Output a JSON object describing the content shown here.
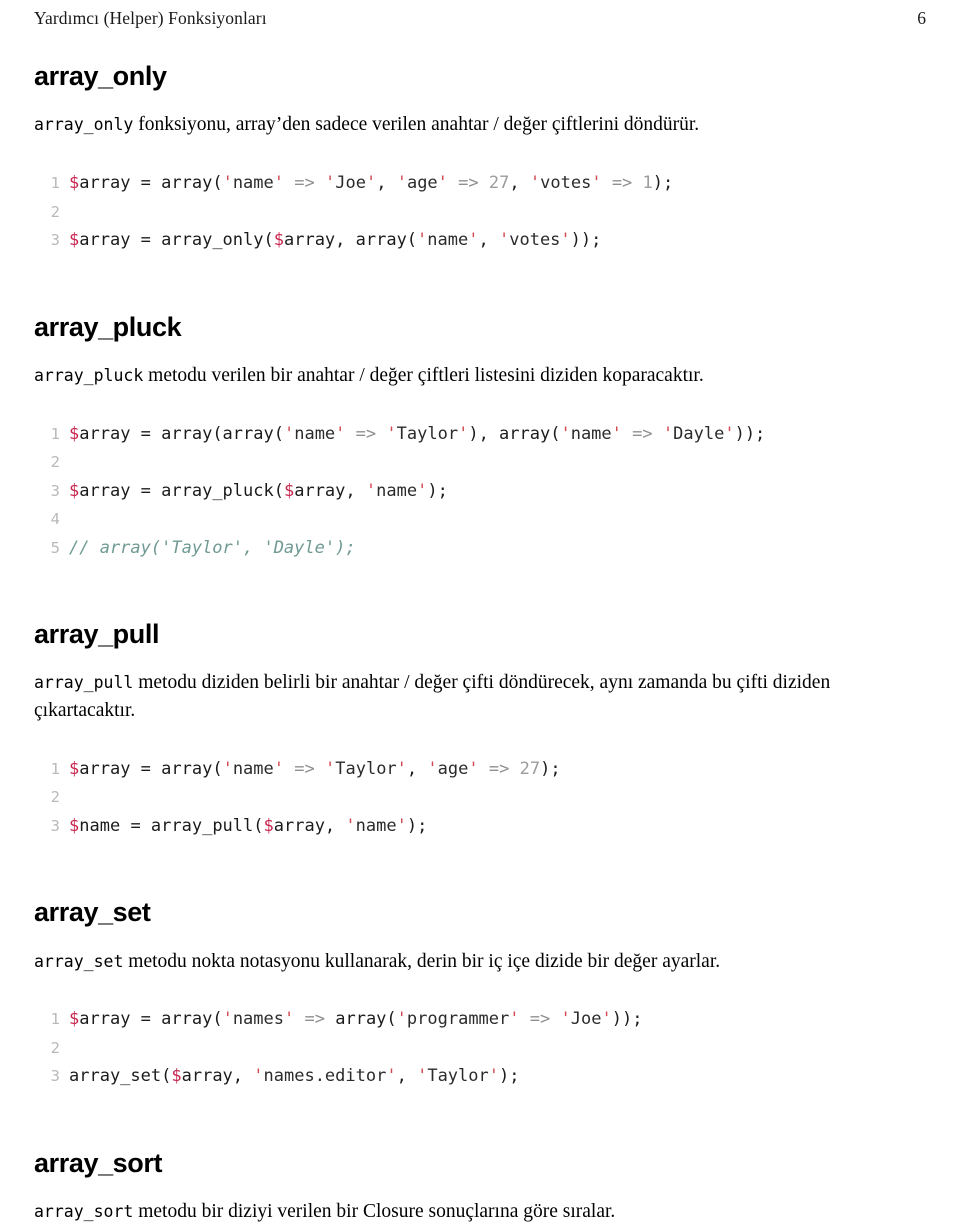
{
  "header": {
    "title": "Yardımcı (Helper) Fonksiyonları",
    "page_number": "6"
  },
  "colors": {
    "variable": "#c7254e",
    "quote": "#d14b52",
    "string": "#2b2b2b",
    "number": "#9c9c9c",
    "operator": "#8f8f8f",
    "comment": "#6f9a93",
    "gutter": "#b9b9b9",
    "text": "#000000",
    "background": "#ffffff"
  },
  "sections": [
    {
      "heading": "array_only",
      "paragraph": {
        "code": "array_only",
        "rest": " fonksiyonu, array’den sadece verilen anahtar / değer çiftlerini döndürür."
      },
      "code_lines": [
        {
          "n": "1",
          "tokens": [
            {
              "t": "$",
              "c": "var"
            },
            {
              "t": "array ",
              "c": "plain"
            },
            {
              "t": "= array(",
              "c": "plain"
            },
            {
              "t": "'",
              "c": "quote"
            },
            {
              "t": "name",
              "c": "str"
            },
            {
              "t": "'",
              "c": "quote"
            },
            {
              "t": " ",
              "c": "plain"
            },
            {
              "t": "=>",
              "c": "op"
            },
            {
              "t": " ",
              "c": "plain"
            },
            {
              "t": "'",
              "c": "quote"
            },
            {
              "t": "Joe",
              "c": "str"
            },
            {
              "t": "'",
              "c": "quote"
            },
            {
              "t": ", ",
              "c": "plain"
            },
            {
              "t": "'",
              "c": "quote"
            },
            {
              "t": "age",
              "c": "str"
            },
            {
              "t": "'",
              "c": "quote"
            },
            {
              "t": " ",
              "c": "plain"
            },
            {
              "t": "=>",
              "c": "op"
            },
            {
              "t": " ",
              "c": "plain"
            },
            {
              "t": "27",
              "c": "num"
            },
            {
              "t": ", ",
              "c": "plain"
            },
            {
              "t": "'",
              "c": "quote"
            },
            {
              "t": "votes",
              "c": "str"
            },
            {
              "t": "'",
              "c": "quote"
            },
            {
              "t": " ",
              "c": "plain"
            },
            {
              "t": "=>",
              "c": "op"
            },
            {
              "t": " ",
              "c": "plain"
            },
            {
              "t": "1",
              "c": "num"
            },
            {
              "t": ");",
              "c": "plain"
            }
          ]
        },
        {
          "n": "2",
          "tokens": []
        },
        {
          "n": "3",
          "tokens": [
            {
              "t": "$",
              "c": "var"
            },
            {
              "t": "array ",
              "c": "plain"
            },
            {
              "t": "= array_only(",
              "c": "plain"
            },
            {
              "t": "$",
              "c": "var"
            },
            {
              "t": "array, array(",
              "c": "plain"
            },
            {
              "t": "'",
              "c": "quote"
            },
            {
              "t": "name",
              "c": "str"
            },
            {
              "t": "'",
              "c": "quote"
            },
            {
              "t": ", ",
              "c": "plain"
            },
            {
              "t": "'",
              "c": "quote"
            },
            {
              "t": "votes",
              "c": "str"
            },
            {
              "t": "'",
              "c": "quote"
            },
            {
              "t": "));",
              "c": "plain"
            }
          ]
        }
      ]
    },
    {
      "heading": "array_pluck",
      "paragraph": {
        "code": "array_pluck",
        "rest": " metodu verilen bir anahtar / değer çiftleri listesini diziden koparacaktır."
      },
      "code_lines": [
        {
          "n": "1",
          "tokens": [
            {
              "t": "$",
              "c": "var"
            },
            {
              "t": "array ",
              "c": "plain"
            },
            {
              "t": "= array(array(",
              "c": "plain"
            },
            {
              "t": "'",
              "c": "quote"
            },
            {
              "t": "name",
              "c": "str"
            },
            {
              "t": "'",
              "c": "quote"
            },
            {
              "t": " ",
              "c": "plain"
            },
            {
              "t": "=>",
              "c": "op"
            },
            {
              "t": " ",
              "c": "plain"
            },
            {
              "t": "'",
              "c": "quote"
            },
            {
              "t": "Taylor",
              "c": "str"
            },
            {
              "t": "'",
              "c": "quote"
            },
            {
              "t": "), array(",
              "c": "plain"
            },
            {
              "t": "'",
              "c": "quote"
            },
            {
              "t": "name",
              "c": "str"
            },
            {
              "t": "'",
              "c": "quote"
            },
            {
              "t": " ",
              "c": "plain"
            },
            {
              "t": "=>",
              "c": "op"
            },
            {
              "t": " ",
              "c": "plain"
            },
            {
              "t": "'",
              "c": "quote"
            },
            {
              "t": "Dayle",
              "c": "str"
            },
            {
              "t": "'",
              "c": "quote"
            },
            {
              "t": "));",
              "c": "plain"
            }
          ]
        },
        {
          "n": "2",
          "tokens": []
        },
        {
          "n": "3",
          "tokens": [
            {
              "t": "$",
              "c": "var"
            },
            {
              "t": "array ",
              "c": "plain"
            },
            {
              "t": "= array_pluck(",
              "c": "plain"
            },
            {
              "t": "$",
              "c": "var"
            },
            {
              "t": "array, ",
              "c": "plain"
            },
            {
              "t": "'",
              "c": "quote"
            },
            {
              "t": "name",
              "c": "str"
            },
            {
              "t": "'",
              "c": "quote"
            },
            {
              "t": ");",
              "c": "plain"
            }
          ]
        },
        {
          "n": "4",
          "tokens": []
        },
        {
          "n": "5",
          "tokens": [
            {
              "t": "// array('Taylor', 'Dayle');",
              "c": "comment"
            }
          ]
        }
      ]
    },
    {
      "heading": "array_pull",
      "paragraph": {
        "code": "array_pull",
        "rest": " metodu diziden belirli bir anahtar / değer çifti döndürecek, aynı zamanda bu çifti diziden çıkartacaktır."
      },
      "code_lines": [
        {
          "n": "1",
          "tokens": [
            {
              "t": "$",
              "c": "var"
            },
            {
              "t": "array ",
              "c": "plain"
            },
            {
              "t": "= array(",
              "c": "plain"
            },
            {
              "t": "'",
              "c": "quote"
            },
            {
              "t": "name",
              "c": "str"
            },
            {
              "t": "'",
              "c": "quote"
            },
            {
              "t": " ",
              "c": "plain"
            },
            {
              "t": "=>",
              "c": "op"
            },
            {
              "t": " ",
              "c": "plain"
            },
            {
              "t": "'",
              "c": "quote"
            },
            {
              "t": "Taylor",
              "c": "str"
            },
            {
              "t": "'",
              "c": "quote"
            },
            {
              "t": ", ",
              "c": "plain"
            },
            {
              "t": "'",
              "c": "quote"
            },
            {
              "t": "age",
              "c": "str"
            },
            {
              "t": "'",
              "c": "quote"
            },
            {
              "t": " ",
              "c": "plain"
            },
            {
              "t": "=>",
              "c": "op"
            },
            {
              "t": " ",
              "c": "plain"
            },
            {
              "t": "27",
              "c": "num"
            },
            {
              "t": ");",
              "c": "plain"
            }
          ]
        },
        {
          "n": "2",
          "tokens": []
        },
        {
          "n": "3",
          "tokens": [
            {
              "t": "$",
              "c": "var"
            },
            {
              "t": "name ",
              "c": "plain"
            },
            {
              "t": "= array_pull(",
              "c": "plain"
            },
            {
              "t": "$",
              "c": "var"
            },
            {
              "t": "array, ",
              "c": "plain"
            },
            {
              "t": "'",
              "c": "quote"
            },
            {
              "t": "name",
              "c": "str"
            },
            {
              "t": "'",
              "c": "quote"
            },
            {
              "t": ");",
              "c": "plain"
            }
          ]
        }
      ]
    },
    {
      "heading": "array_set",
      "paragraph": {
        "code": "array_set",
        "rest": " metodu nokta notasyonu kullanarak, derin bir iç içe dizide bir değer ayarlar."
      },
      "code_lines": [
        {
          "n": "1",
          "tokens": [
            {
              "t": "$",
              "c": "var"
            },
            {
              "t": "array ",
              "c": "plain"
            },
            {
              "t": "= array(",
              "c": "plain"
            },
            {
              "t": "'",
              "c": "quote"
            },
            {
              "t": "names",
              "c": "str"
            },
            {
              "t": "'",
              "c": "quote"
            },
            {
              "t": " ",
              "c": "plain"
            },
            {
              "t": "=>",
              "c": "op"
            },
            {
              "t": " ",
              "c": "plain"
            },
            {
              "t": "array(",
              "c": "plain"
            },
            {
              "t": "'",
              "c": "quote"
            },
            {
              "t": "programmer",
              "c": "str"
            },
            {
              "t": "'",
              "c": "quote"
            },
            {
              "t": " ",
              "c": "plain"
            },
            {
              "t": "=>",
              "c": "op"
            },
            {
              "t": " ",
              "c": "plain"
            },
            {
              "t": "'",
              "c": "quote"
            },
            {
              "t": "Joe",
              "c": "str"
            },
            {
              "t": "'",
              "c": "quote"
            },
            {
              "t": "));",
              "c": "plain"
            }
          ]
        },
        {
          "n": "2",
          "tokens": []
        },
        {
          "n": "3",
          "tokens": [
            {
              "t": "array_set(",
              "c": "plain"
            },
            {
              "t": "$",
              "c": "var"
            },
            {
              "t": "array, ",
              "c": "plain"
            },
            {
              "t": "'",
              "c": "quote"
            },
            {
              "t": "names.editor",
              "c": "str"
            },
            {
              "t": "'",
              "c": "quote"
            },
            {
              "t": ", ",
              "c": "plain"
            },
            {
              "t": "'",
              "c": "quote"
            },
            {
              "t": "Taylor",
              "c": "str"
            },
            {
              "t": "'",
              "c": "quote"
            },
            {
              "t": ");",
              "c": "plain"
            }
          ]
        }
      ]
    },
    {
      "heading": "array_sort",
      "paragraph": {
        "code": "array_sort",
        "rest": " metodu bir diziyi verilen bir Closure sonuçlarına göre sıralar."
      },
      "code_lines": []
    }
  ]
}
